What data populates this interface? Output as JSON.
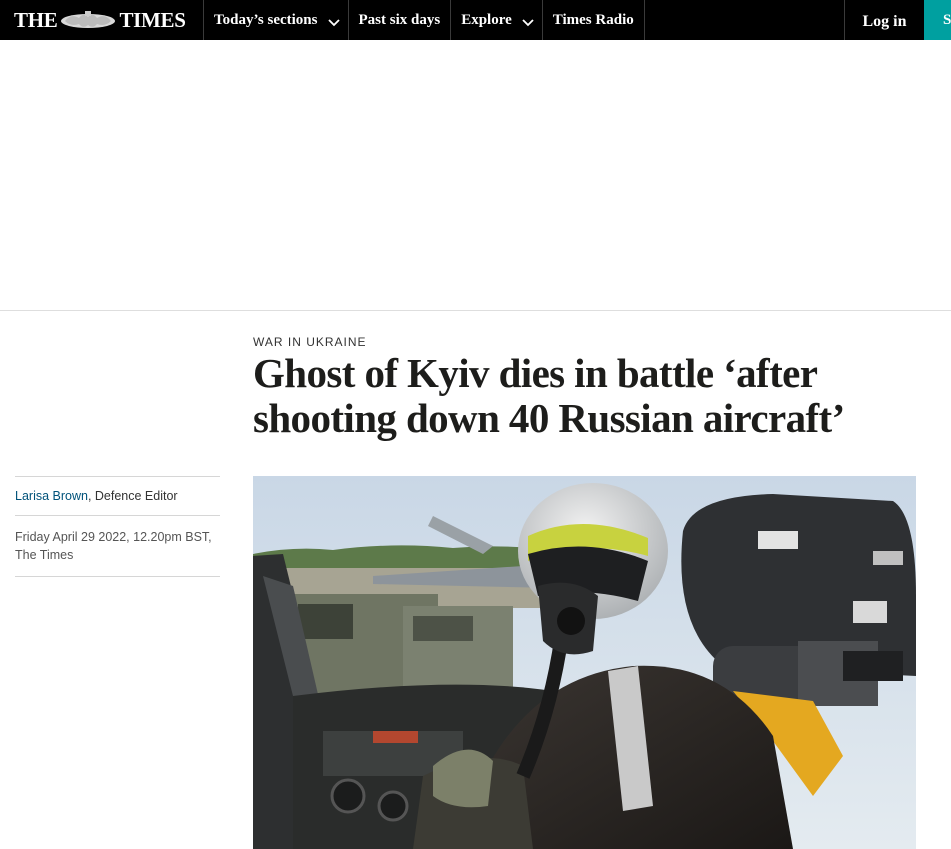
{
  "nav": {
    "logo_left": "THE",
    "logo_right": "TIMES",
    "items": [
      {
        "label": "Today’s sections",
        "has_dropdown": true
      },
      {
        "label": "Past six days",
        "has_dropdown": false
      },
      {
        "label": "Explore",
        "has_dropdown": true
      },
      {
        "label": "Times Radio",
        "has_dropdown": false
      }
    ],
    "login_label": "Log in",
    "subscribe_label": "S"
  },
  "article": {
    "section": "WAR IN UKRAINE",
    "headline_line1": "Ghost of Kyiv dies in battle ‘after",
    "headline_line2": "shooting down 40 Russian aircraft’",
    "author": "Larisa Brown",
    "author_role": ", Defence Editor",
    "date_line1": "Friday April 29 2022, 12.20pm BST,",
    "date_line2": "The Times"
  },
  "icons": {
    "dropdown": "chevron-down-icon",
    "crest": "royal-crest-icon"
  },
  "colors": {
    "nav_bg": "#000000",
    "subscribe_bg": "#00a0a0",
    "author_link": "#00527a"
  }
}
